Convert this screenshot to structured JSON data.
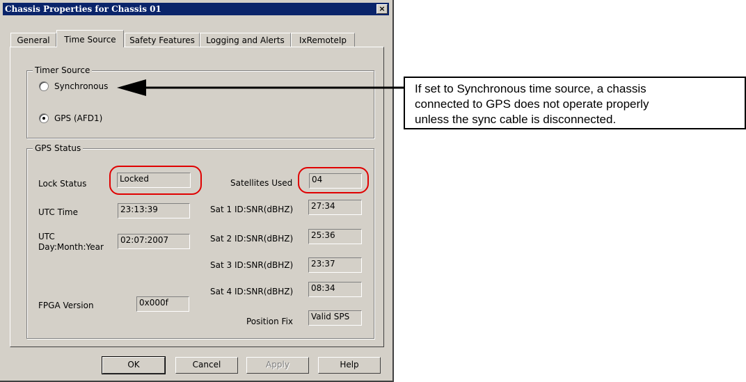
{
  "window": {
    "title": "Chassis Properties for Chassis 01",
    "close_glyph": "×"
  },
  "tabs": [
    {
      "label": "General",
      "active": false
    },
    {
      "label": "Time Source",
      "active": true
    },
    {
      "label": "Safety Features",
      "active": false
    },
    {
      "label": "Logging and Alerts",
      "active": false
    },
    {
      "label": "IxRemoteIp",
      "active": false
    }
  ],
  "timer_source": {
    "group_label": "Timer Source",
    "options": [
      {
        "label": "Synchronous",
        "checked": false
      },
      {
        "label": "GPS (AFD1)",
        "checked": true
      }
    ]
  },
  "gps_status": {
    "group_label": "GPS Status",
    "lock_status": {
      "label": "Lock Status",
      "value": "Locked"
    },
    "utc_time": {
      "label": "UTC Time",
      "value": "23:13:39"
    },
    "utc_date": {
      "label_line1": "UTC",
      "label_line2": "Day:Month:Year",
      "value": "02:07:2007"
    },
    "fpga_version": {
      "label": "FPGA Version",
      "value": "0x000f"
    },
    "satellites_used": {
      "label": "Satellites Used",
      "value": "04"
    },
    "sat1": {
      "label": "Sat 1 ID:SNR(dBHZ)",
      "value": "27:34"
    },
    "sat2": {
      "label": "Sat 2 ID:SNR(dBHZ)",
      "value": "25:36"
    },
    "sat3": {
      "label": "Sat 3 ID:SNR(dBHZ)",
      "value": "23:37"
    },
    "sat4": {
      "label": "Sat 4 ID:SNR(dBHZ)",
      "value": "08:34"
    },
    "position_fix": {
      "label": "Position Fix",
      "value": "Valid SPS"
    }
  },
  "buttons": {
    "ok": "OK",
    "cancel": "Cancel",
    "apply": "Apply",
    "help": "Help"
  },
  "callout": {
    "line1": "If set to Synchronous time source, a chassis",
    "line2": "connected to GPS does not operate properly",
    "line3": "unless the sync cable is disconnected."
  },
  "colors": {
    "dialog_bg": "#d4d0c8",
    "titlebar": "#0a246a",
    "highlight_oval": "#e00000"
  }
}
